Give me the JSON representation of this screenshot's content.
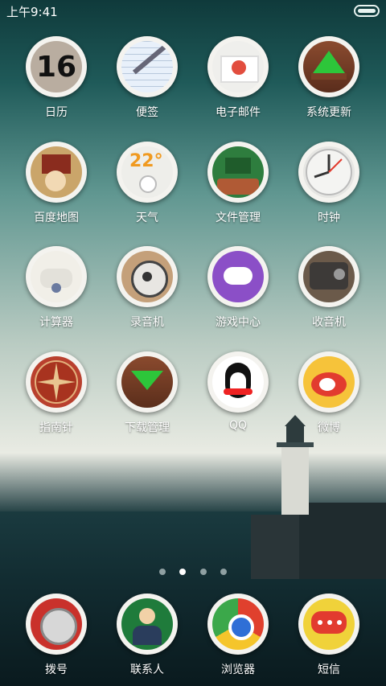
{
  "status": {
    "time": "上午9:41"
  },
  "apps": [
    {
      "label": "日历",
      "day": "16"
    },
    {
      "label": "便签"
    },
    {
      "label": "电子邮件"
    },
    {
      "label": "系统更新"
    },
    {
      "label": "百度地图"
    },
    {
      "label": "天气",
      "temp": "22°"
    },
    {
      "label": "文件管理"
    },
    {
      "label": "时钟"
    },
    {
      "label": "计算器"
    },
    {
      "label": "录音机"
    },
    {
      "label": "游戏中心"
    },
    {
      "label": "收音机"
    },
    {
      "label": "指南针"
    },
    {
      "label": "下载管理"
    },
    {
      "label": "QQ"
    },
    {
      "label": "微博"
    }
  ],
  "dock": [
    {
      "label": "拨号"
    },
    {
      "label": "联系人"
    },
    {
      "label": "浏览器"
    },
    {
      "label": "短信"
    }
  ],
  "pager": {
    "pages": 4,
    "current": 2
  }
}
